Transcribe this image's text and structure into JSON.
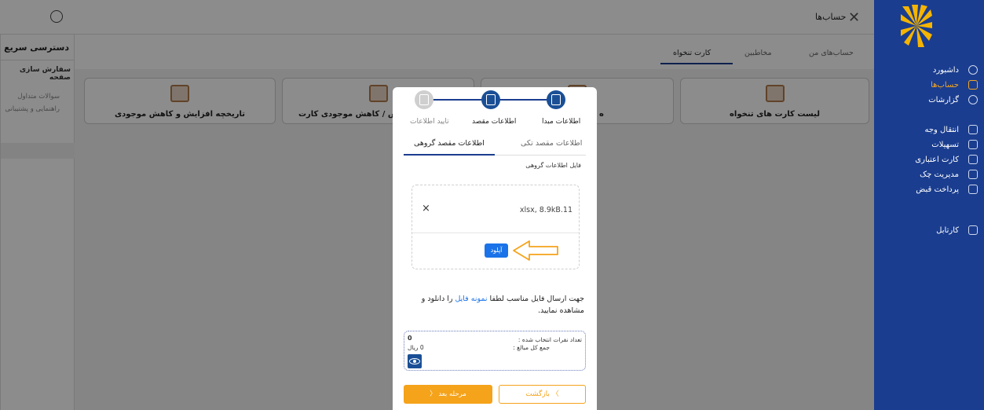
{
  "topbar": {
    "title": "حساب‌ها"
  },
  "sidebar": {
    "items": [
      {
        "label": "داشبورد",
        "icon": "dashboard-icon"
      },
      {
        "label": "حساب‌ها",
        "icon": "accounts-icon",
        "active": true
      },
      {
        "label": "گزارشات",
        "icon": "reports-icon"
      },
      {
        "label": "انتقال وجه",
        "icon": "transfer-icon"
      },
      {
        "label": "تسهیلات",
        "icon": "facilities-icon"
      },
      {
        "label": "کارت اعتباری",
        "icon": "credit-card-icon"
      },
      {
        "label": "مدیریت چک",
        "icon": "cheque-icon"
      },
      {
        "label": "پرداخت قبض",
        "icon": "bill-icon"
      },
      {
        "label": "کارتابل",
        "icon": "cartable-icon"
      }
    ]
  },
  "quick_access": {
    "title": "دسترسی سریع",
    "customize": "سفارش سازی صفحه",
    "links": [
      "سوالات متداول",
      "راهنمایی و پشتیبانی"
    ]
  },
  "main": {
    "tabs": [
      {
        "label": "حساب‌های من"
      },
      {
        "label": "مخاطبین"
      },
      {
        "label": "کارت تنخواه",
        "active": true
      }
    ],
    "cards": [
      {
        "label": "لیست کارت های تنخواه"
      },
      {
        "label": "ه"
      },
      {
        "label": "افزایش / کاهش موجودی کارت"
      },
      {
        "label": "تاریخچه افزایش و کاهش موجودی"
      }
    ]
  },
  "modal": {
    "steps": [
      {
        "label": "اطلاعات مبدا",
        "state": "done"
      },
      {
        "label": "اطلاعات مقصد",
        "state": "current"
      },
      {
        "label": "تایید اطلاعات",
        "state": "pending"
      }
    ],
    "tabs": [
      {
        "label": "اطلاعات مقصد تکی"
      },
      {
        "label": "اطلاعات مقصد گروهی",
        "active": true
      }
    ],
    "file_section_label": "فایل اطلاعات گروهی",
    "file": {
      "name": "xlsx, 8.9kB.11",
      "remove_glyph": "×"
    },
    "upload_label": "آپلود",
    "hint_before": "جهت ارسال فایل مناسب لطفا ",
    "hint_link": "نمونه فایل",
    "hint_after": " را دانلود و مشاهده نمایید.",
    "summary": {
      "count_label": "تعداد نفرات انتخاب شده :",
      "count_value": "0",
      "amount_label": "جمع کل مبالغ :",
      "amount_value": "0 ریال"
    },
    "next_label": "مرحله بعد  〈",
    "back_label": "〉  بازگشت"
  },
  "colors": {
    "primary": "#1a3d8f",
    "accent": "#f5a31a",
    "link": "#1a73e8"
  }
}
